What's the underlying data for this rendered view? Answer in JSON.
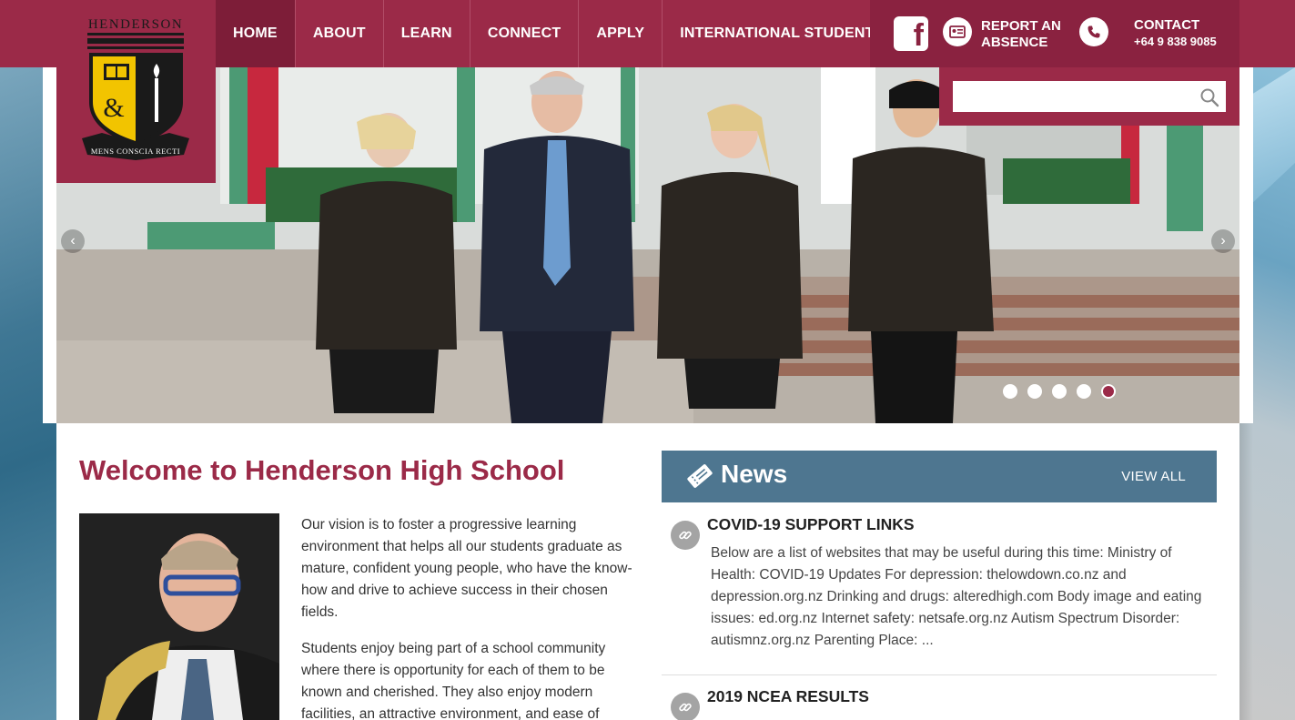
{
  "logo": {
    "name": "HENDERSON",
    "motto": "MENS CONSCIA RECTI"
  },
  "nav": {
    "items": [
      {
        "label": "HOME"
      },
      {
        "label": "ABOUT"
      },
      {
        "label": "LEARN"
      },
      {
        "label": "CONNECT"
      },
      {
        "label": "APPLY"
      },
      {
        "label": "INTERNATIONAL STUDENTS"
      }
    ]
  },
  "utility": {
    "facebook_icon": "facebook-icon",
    "report_line1": "REPORT AN",
    "report_line2": "ABSENCE",
    "contact_label": "CONTACT",
    "contact_phone": "+64 9 838 9085"
  },
  "search": {
    "value": "",
    "placeholder": ""
  },
  "hero": {
    "slides": 5,
    "active_slide": 5
  },
  "welcome": {
    "title": "Welcome to Henderson High School",
    "paragraphs": [
      "Our vision is to foster a progressive learning environment that helps all our students graduate as mature, confident young people, who have the know-how and drive to achieve success in their chosen fields.",
      "Students enjoy being part of a school community where there is opportunity for each of them to be known and cherished. They also enjoy modern facilities, an attractive environment, and ease of"
    ]
  },
  "news": {
    "title": "News",
    "view_all": "VIEW ALL",
    "items": [
      {
        "title": "COVID-19 SUPPORT LINKS",
        "body": "Below are a list of websites that may be useful during this time: Ministry of Health: COVID-19 Updates For depression: thelowdown.co.nz and depression.org.nz Drinking and drugs: alteredhigh.com Body image and eating issues: ed.org.nz Internet safety: netsafe.org.nz Autism Spectrum Disorder: autismnz.org.nz Parenting Place: ..."
      },
      {
        "title": "2019 NCEA RESULTS",
        "body": ""
      }
    ]
  },
  "colors": {
    "brand": "#9b2a48",
    "brand_dark": "#8a2240",
    "news_header": "#4e7690"
  }
}
